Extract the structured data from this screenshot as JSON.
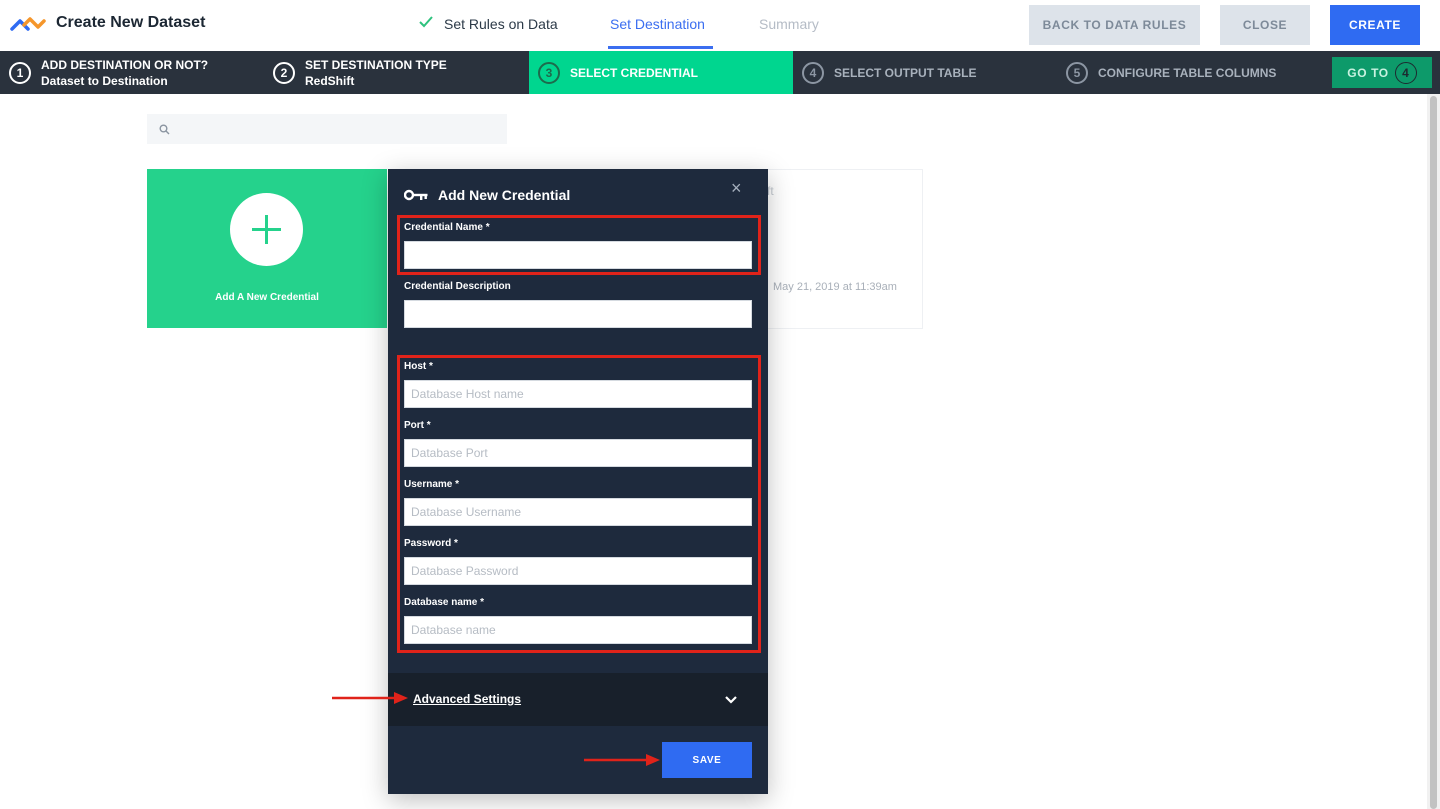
{
  "header": {
    "app_title": "Create New Dataset",
    "tabs": [
      {
        "label": "Set Rules on Data",
        "state": "done"
      },
      {
        "label": "Set Destination",
        "state": "active"
      },
      {
        "label": "Summary",
        "state": "pending"
      }
    ],
    "buttons": {
      "back": "BACK TO DATA RULES",
      "close": "CLOSE",
      "create": "CREATE"
    }
  },
  "steps": [
    {
      "num": "1",
      "title": "ADD DESTINATION OR NOT?",
      "subtitle": "Dataset to Destination"
    },
    {
      "num": "2",
      "title": "SET DESTINATION TYPE",
      "subtitle": "RedShift"
    },
    {
      "num": "3",
      "title": "SELECT CREDENTIAL",
      "subtitle": ""
    },
    {
      "num": "4",
      "title": "SELECT OUTPUT TABLE",
      "subtitle": ""
    },
    {
      "num": "5",
      "title": "CONFIGURE TABLE COLUMNS",
      "subtitle": ""
    }
  ],
  "goto": {
    "label": "GO TO",
    "num": "4"
  },
  "search": {
    "placeholder": "",
    "value": ""
  },
  "add_card": {
    "label": "Add A New Credential"
  },
  "background_card": {
    "title_fragment": "ft",
    "date": "May 21, 2019 at 11:39am"
  },
  "modal": {
    "title": "Add New Credential",
    "close_glyph": "×",
    "fields": {
      "credential_name": {
        "label": "Credential Name *",
        "value": "",
        "placeholder": ""
      },
      "credential_description": {
        "label": "Credential Description",
        "value": "",
        "placeholder": ""
      },
      "host": {
        "label": "Host *",
        "value": "",
        "placeholder": "Database Host name"
      },
      "port": {
        "label": "Port *",
        "value": "",
        "placeholder": "Database Port"
      },
      "username": {
        "label": "Username *",
        "value": "",
        "placeholder": "Database Username"
      },
      "password": {
        "label": "Password *",
        "value": "",
        "placeholder": "Database Password"
      },
      "database_name": {
        "label": "Database name *",
        "value": "",
        "placeholder": "Database name"
      }
    },
    "advanced_settings": "Advanced Settings",
    "save": "SAVE"
  },
  "colors": {
    "accent_blue": "#2f6bf2",
    "active_step_green": "#00d68f",
    "add_card_green": "#25d28c",
    "modal_bg": "#1e2a3d",
    "annotation_red": "#e0231a"
  }
}
